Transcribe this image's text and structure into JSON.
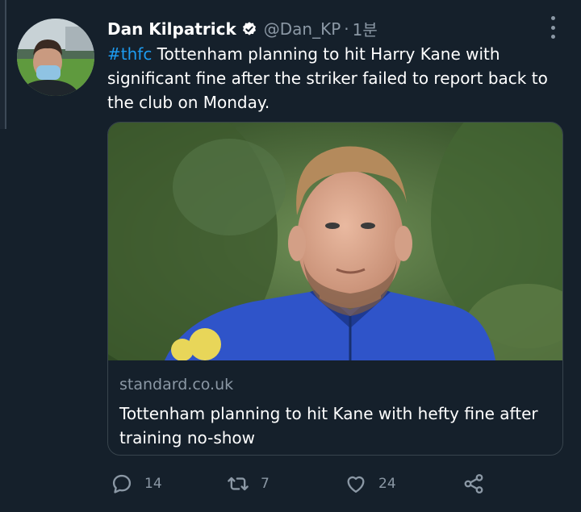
{
  "tweet": {
    "author_name": "Dan Kilpatrick",
    "handle": "@Dan_KP",
    "separator": "·",
    "time": "1분",
    "hashtag": "#thfc",
    "text": " Tottenham planning to hit Harry Kane with significant fine after the striker failed to report back to the club on Monday."
  },
  "card": {
    "domain": "standard.co.uk",
    "title": "Tottenham planning to hit Kane with hefty fine after training no-show"
  },
  "actions": {
    "reply_count": "14",
    "retweet_count": "7",
    "like_count": "24"
  },
  "colors": {
    "background": "#15202b",
    "accent": "#1d9bf0",
    "muted": "#8b98a5",
    "border": "#38444d"
  },
  "icons": [
    "verified-badge-icon",
    "more-options-icon",
    "reply-icon",
    "retweet-icon",
    "like-icon",
    "share-icon"
  ]
}
